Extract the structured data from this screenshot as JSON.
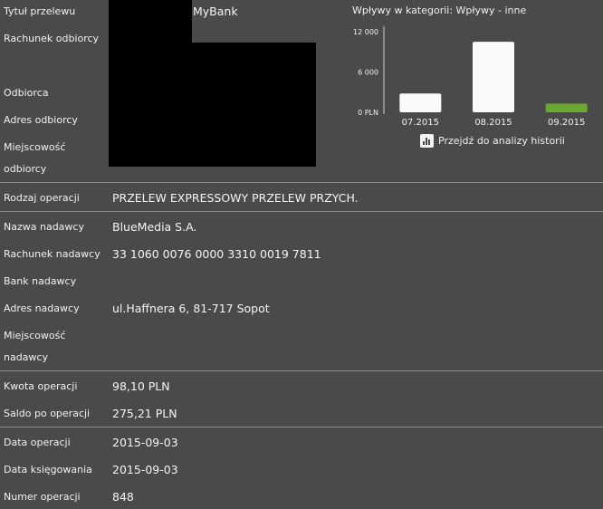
{
  "top": {
    "title_label": "Tytuł przelewu",
    "title_value": "MyBank",
    "recipient_account_label": "Rachunek odbiorcy",
    "recipient_label": "Odbiorca",
    "recipient_address_label": "Adres odbiorcy",
    "recipient_city_label_1": "Miejscowość",
    "recipient_city_label_2": "odbiorcy"
  },
  "chart": {
    "heading": "Wpływy w kategorii:  Wpływy - inne",
    "link_label": "Przejdź do analizy historii",
    "link_icon": "bar-chart-icon"
  },
  "chart_data": {
    "type": "bar",
    "categories": [
      "07.2015",
      "08.2015",
      "09.2015"
    ],
    "values": [
      2800,
      10500,
      1300
    ],
    "ylim": [
      0,
      12000
    ],
    "yticks": [
      "12 000",
      "6 000",
      "0 PLN"
    ],
    "colors": [
      "#fafafa",
      "#fafafa",
      "#6aa832"
    ],
    "grid": false
  },
  "operation": {
    "type_label": "Rodzaj operacji",
    "type_value": "PRZELEW EXPRESSOWY PRZELEW PRZYCH."
  },
  "sender": {
    "name_label": "Nazwa nadawcy",
    "name_value": "BlueMedia S.A.",
    "account_label": "Rachunek nadawcy",
    "account_value": "33 1060 0076 0000 3310 0019 7811",
    "bank_label": "Bank nadawcy",
    "address_label": "Adres nadawcy",
    "address_value": "ul.Haffnera 6, 81-717 Sopot",
    "city_label_1": "Miejscowość",
    "city_label_2": "nadawcy"
  },
  "amounts": {
    "amount_label": "Kwota operacji",
    "amount_value": "98,10 PLN",
    "balance_label": "Saldo po operacji",
    "balance_value": "275,21 PLN"
  },
  "dates": {
    "op_date_label": "Data operacji",
    "op_date_value": "2015-09-03",
    "book_date_label": "Data księgowania",
    "book_date_value": "2015-09-03",
    "op_number_label": "Numer operacji",
    "op_number_value": "848"
  }
}
